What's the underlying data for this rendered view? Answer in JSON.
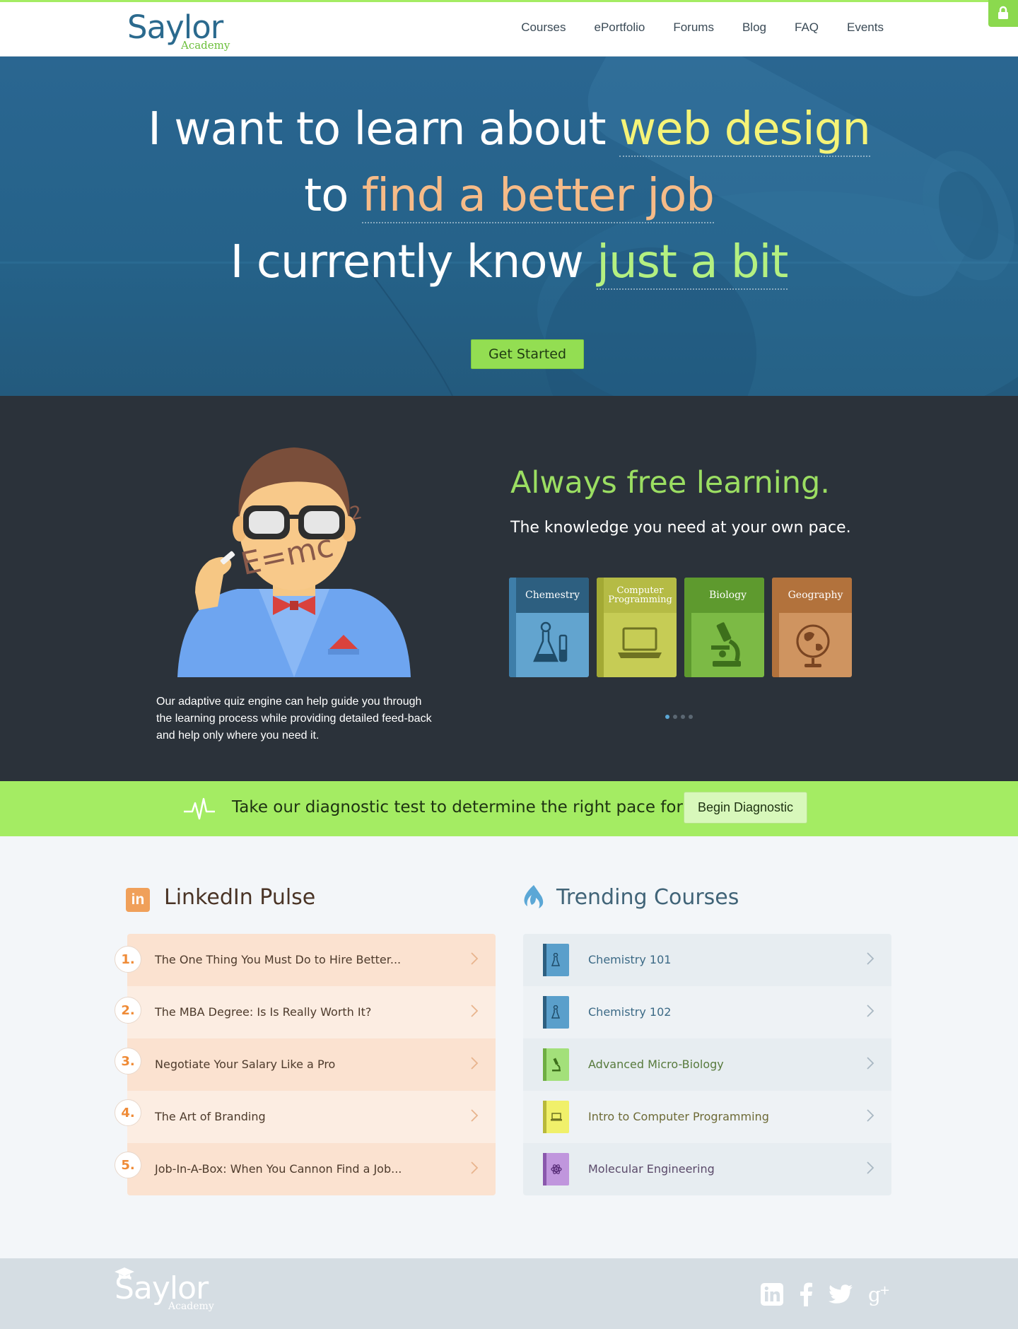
{
  "header": {
    "logo_main": "Saylor",
    "logo_sub": "Academy",
    "nav": [
      "Courses",
      "ePortfolio",
      "Forums",
      "Blog",
      "FAQ",
      "Events"
    ]
  },
  "hero": {
    "line1_prefix": "I want to learn about ",
    "line1_highlight": "web design",
    "line2_prefix": "to ",
    "line2_highlight": "find a better job",
    "line3_prefix": "I currently know ",
    "line3_highlight": "just a bit",
    "cta": "Get Started"
  },
  "free_learning": {
    "illustration_text": "E=mc²",
    "description": "Our adaptive quiz engine can help guide you through the learning process while providing detailed feed-back and help only where you need it.",
    "title": "Always free learning.",
    "subtitle": "The knowledge you need at your own pace.",
    "books": [
      {
        "label": "Chemestry",
        "icon": "chemistry-icon"
      },
      {
        "label": "Computer Programming",
        "icon": "laptop-icon"
      },
      {
        "label": "Biology",
        "icon": "microscope-icon"
      },
      {
        "label": "Geography",
        "icon": "globe-icon"
      }
    ]
  },
  "diagnostic": {
    "text": "Take our diagnostic test to determine the right pace for you.",
    "button": "Begin Diagnostic"
  },
  "linkedin": {
    "title": "LinkedIn Pulse",
    "logo_text": "in",
    "items": [
      {
        "num": "1.",
        "text": "The One Thing You Must Do to Hire Better..."
      },
      {
        "num": "2.",
        "text": "The MBA Degree: Is Is Really Worth It?"
      },
      {
        "num": "3.",
        "text": "Negotiate Your Salary Like a Pro"
      },
      {
        "num": "4.",
        "text": "The Art of Branding"
      },
      {
        "num": "5.",
        "text": "Job-In-A-Box: When You Cannon Find a Job..."
      }
    ]
  },
  "trending": {
    "title": "Trending Courses",
    "items": [
      {
        "text": "Chemistry 101",
        "color": "#5a9fcb",
        "spine": "#3e7ea9",
        "text_color": "#3c6a86"
      },
      {
        "text": "Chemistry 102",
        "color": "#5a9fcb",
        "spine": "#3e7ea9",
        "text_color": "#3c6a86"
      },
      {
        "text": "Advanced Micro-Biology",
        "color": "#a3e07a",
        "spine": "#76bb4a",
        "text_color": "#577a3c"
      },
      {
        "text": "Intro to Computer Programming",
        "color": "#f0f06a",
        "spine": "#c5c540",
        "text_color": "#6d6a36"
      },
      {
        "text": "Molecular Engineering",
        "color": "#c096dd",
        "spine": "#9463b8",
        "text_color": "#5b4a6a"
      }
    ]
  },
  "footer": {
    "logo_main": "Saylor",
    "logo_sub": "Academy",
    "socials": [
      "linkedin-icon",
      "facebook-icon",
      "twitter-icon",
      "google-plus-icon"
    ]
  },
  "colors": {
    "brand_green": "#a4ec63",
    "brand_blue": "#2b6a8e",
    "dark_band": "#2b323a"
  }
}
